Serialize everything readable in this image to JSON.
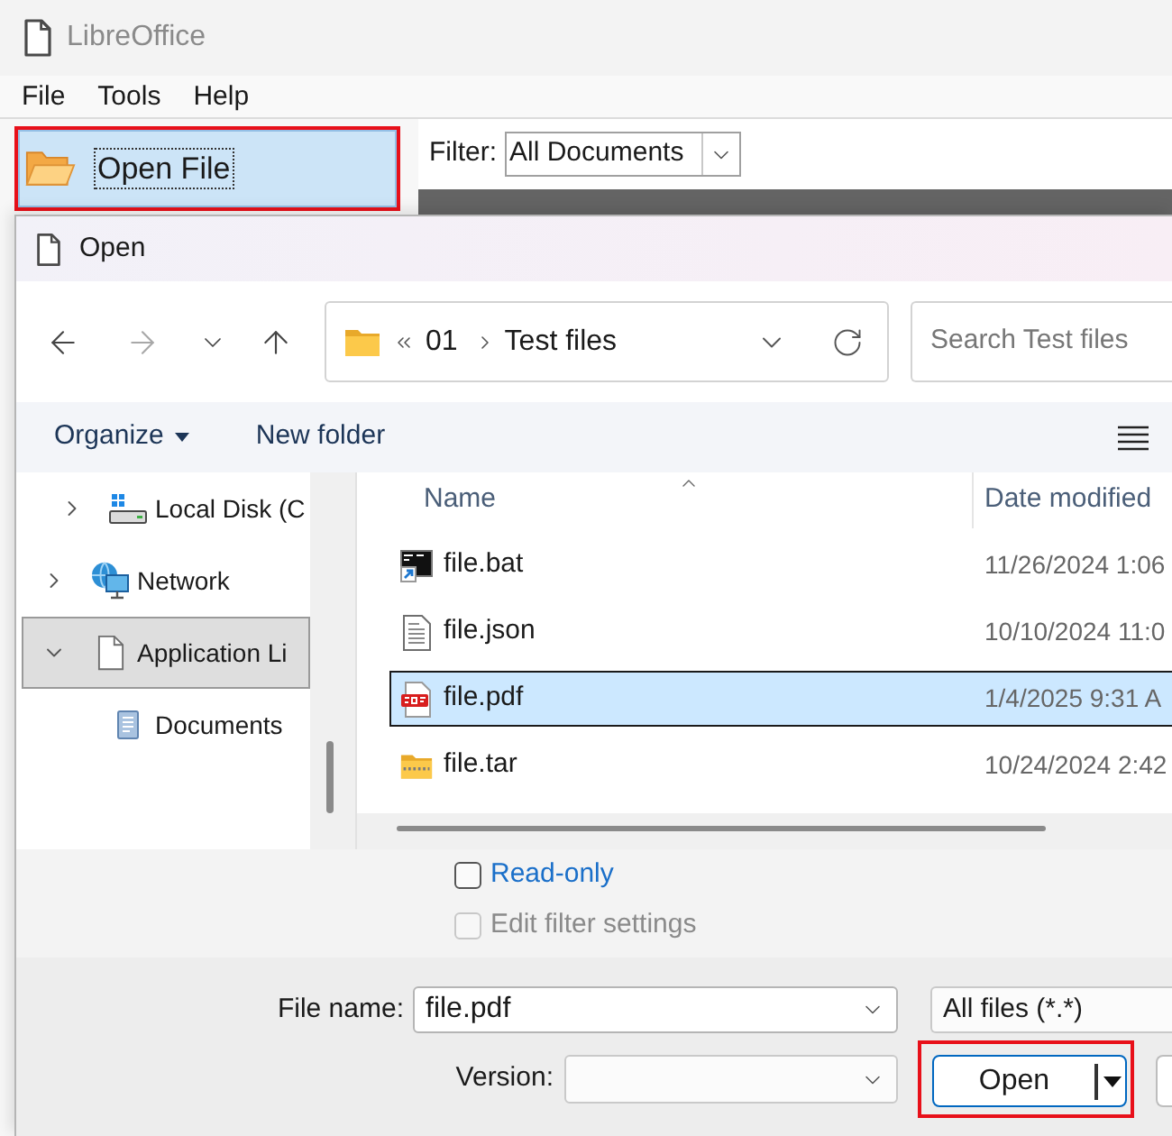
{
  "window": {
    "title": "LibreOffice"
  },
  "menu": [
    "File",
    "Tools",
    "Help"
  ],
  "start_center": {
    "open_file_button": {
      "label": "Open File",
      "highlighted": true,
      "focused": true
    },
    "filter": {
      "label": "Filter:",
      "value": "All Documents"
    }
  },
  "dialog": {
    "title": "Open",
    "nav_buttons": [
      {
        "kind": "back",
        "disabled": false
      },
      {
        "kind": "forward",
        "disabled": true
      },
      {
        "kind": "recent",
        "disabled": false
      },
      {
        "kind": "up",
        "disabled": false
      }
    ],
    "address": {
      "truncated": true,
      "crumbs": [
        "01",
        "Test files"
      ]
    },
    "search": {
      "placeholder": "Search Test files"
    },
    "commands": [
      {
        "label": "Organize",
        "kind": "menu"
      },
      {
        "label": "New folder",
        "kind": "action"
      }
    ],
    "tree": [
      {
        "children": [
          {
            "label": "Local Disk (C",
            "kind": "drive",
            "expanded": false,
            "selected": false
          }
        ]
      },
      {
        "label": "Network",
        "kind": "network",
        "expanded": false,
        "selected": false
      },
      {
        "label": "Application Li",
        "kind": "page",
        "expanded": true,
        "selected": true,
        "children": [
          {
            "label": "Documents",
            "kind": "documents",
            "selected": false
          }
        ]
      }
    ],
    "columns": [
      {
        "label": "Name",
        "sorted": true
      },
      {
        "label": "Date modified",
        "sorted": false
      }
    ],
    "files": [
      {
        "name": "file.bat",
        "kind": "bat",
        "date": "11/26/2024 1:06",
        "selected": false
      },
      {
        "name": "file.json",
        "kind": "json",
        "date": "10/10/2024 11:0",
        "selected": false
      },
      {
        "name": "file.pdf",
        "kind": "pdf",
        "date": "1/4/2025 9:31 A",
        "selected": true
      },
      {
        "name": "file.tar",
        "kind": "tar",
        "date": "10/24/2024 2:42",
        "selected": false
      }
    ],
    "options": [
      {
        "label": "Read-only",
        "checked": false,
        "disabled": false
      },
      {
        "label": "Edit filter settings",
        "checked": false,
        "disabled": true
      }
    ],
    "file_name": {
      "label": "File name:",
      "value": "file.pdf"
    },
    "file_type": {
      "value": "All files (*.*)"
    },
    "version": {
      "label": "Version:"
    },
    "open_button": {
      "label": "Open",
      "highlighted": true
    }
  }
}
